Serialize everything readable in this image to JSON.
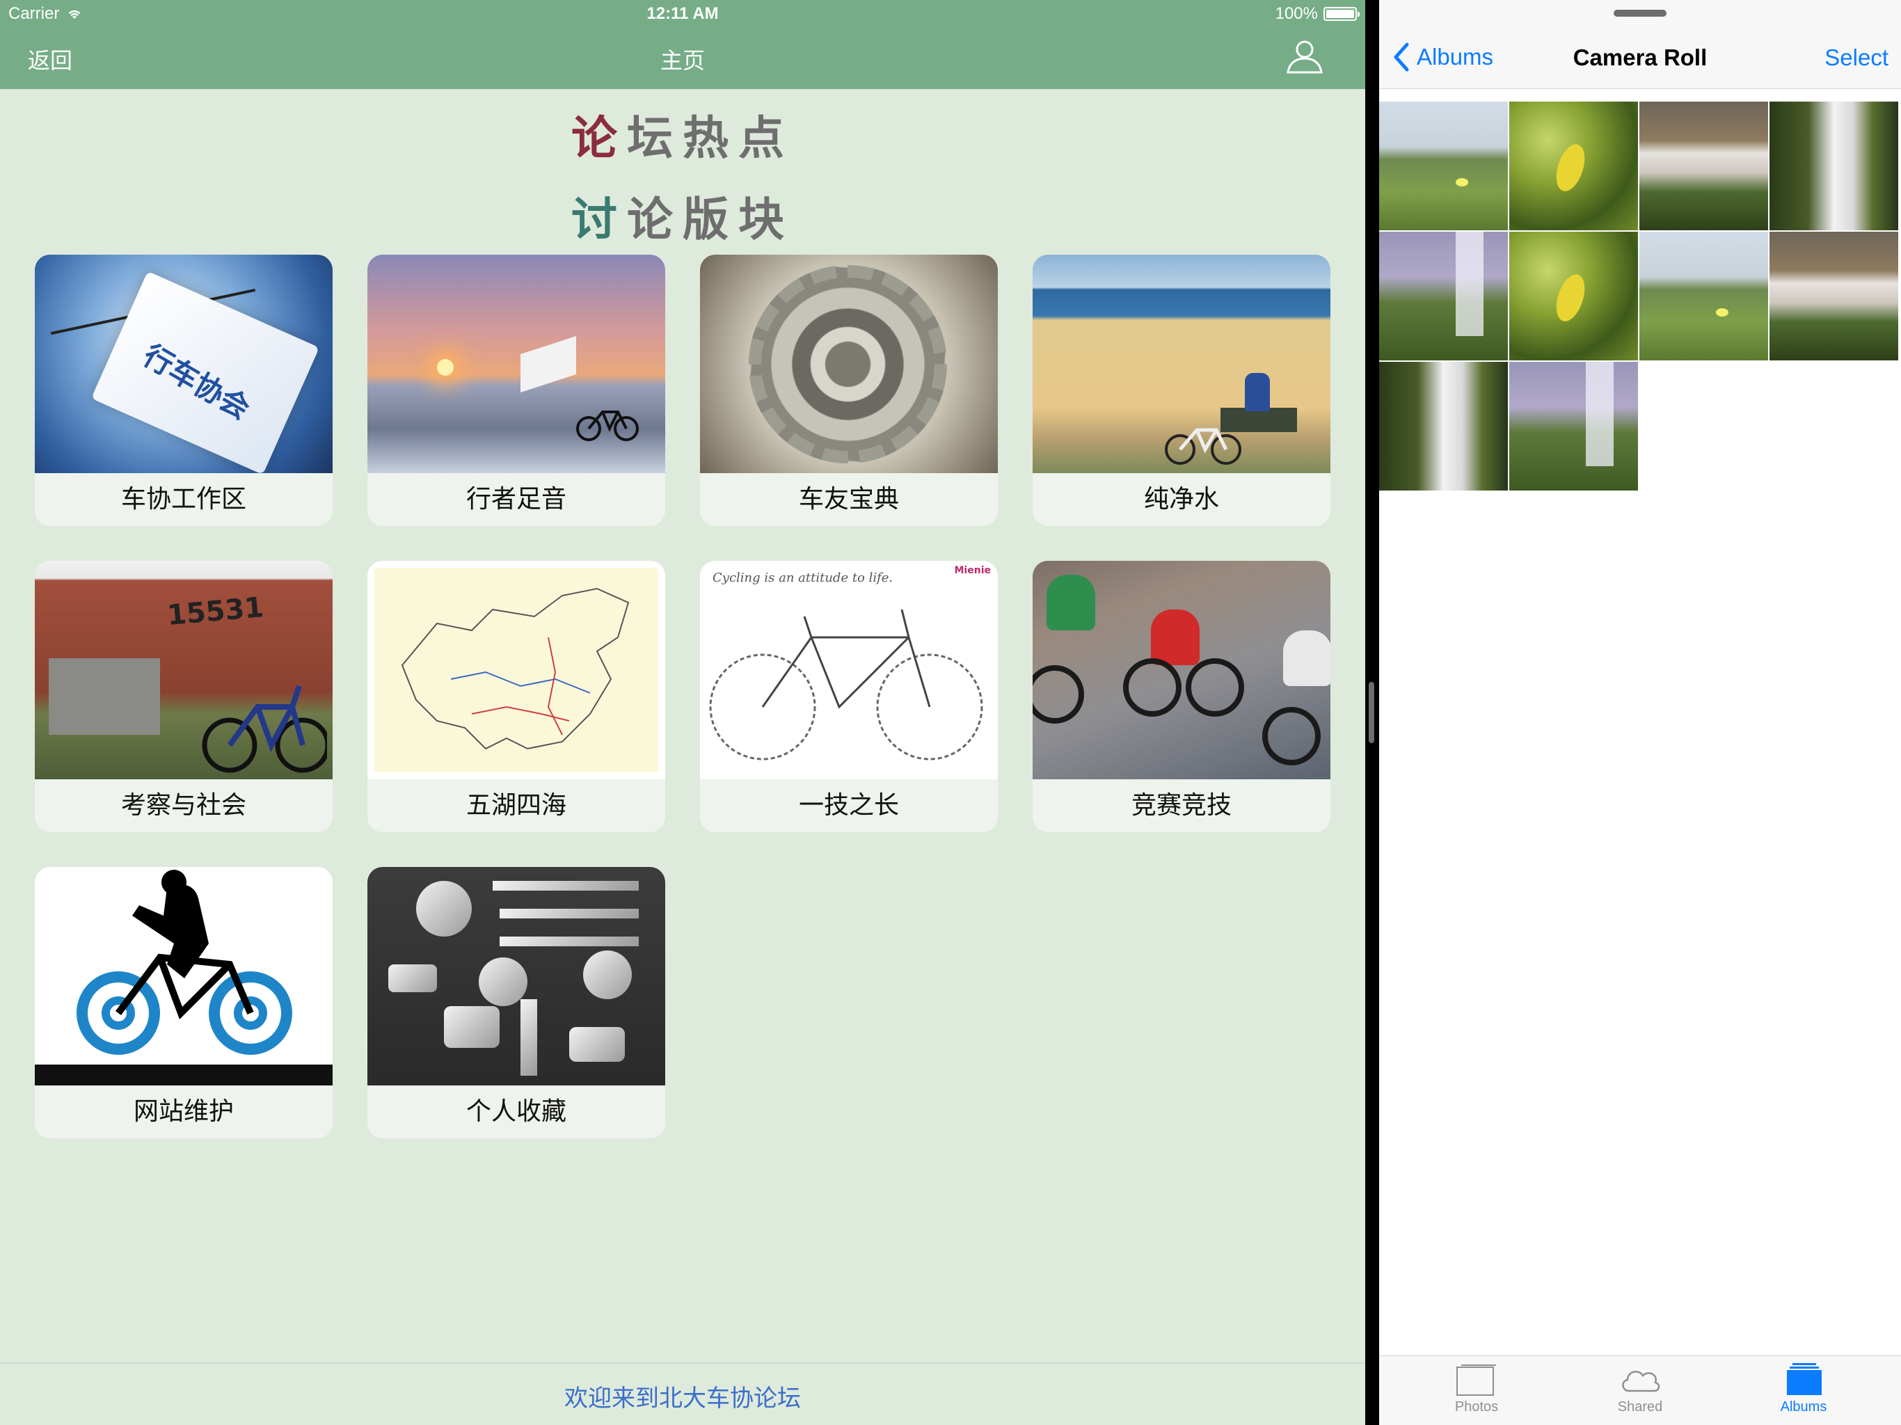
{
  "status_bar": {
    "carrier": "Carrier",
    "time": "12:11 AM",
    "battery": "100%"
  },
  "left_app": {
    "nav": {
      "back_label": "返回",
      "title": "主页",
      "user_icon": "user-icon"
    },
    "banners": {
      "hot_first": "论",
      "hot_rest": "坛热点",
      "board_first": "讨",
      "board_rest": "论版块"
    },
    "boards": [
      {
        "label": "车协工作区",
        "thumb_text": "行车协会"
      },
      {
        "label": "行者足音"
      },
      {
        "label": "车友宝典"
      },
      {
        "label": "纯净水"
      },
      {
        "label": "考察与社会",
        "thumb_text": "15531"
      },
      {
        "label": "五湖四海"
      },
      {
        "label": "一技之长",
        "thumb_text": "Cycling is an attitude to life.",
        "brand": "Mienie"
      },
      {
        "label": "竞赛竞技"
      },
      {
        "label": "网站维护"
      },
      {
        "label": "个人收藏"
      }
    ],
    "footer": "欢迎来到北大车协论坛",
    "colors": {
      "nav": "#76ad86",
      "background": "#deeadc",
      "footer_text": "#3b6fcb"
    }
  },
  "right_app": {
    "nav": {
      "back_label": "Albums",
      "title": "Camera Roll",
      "select_label": "Select"
    },
    "photos": [
      "grass",
      "leaf",
      "falls",
      "waterfall",
      "mist",
      "leaf",
      "grass",
      "falls",
      "waterfall",
      "mist"
    ],
    "tabs": [
      {
        "label": "Photos",
        "icon": "photos-icon",
        "active": false
      },
      {
        "label": "Shared",
        "icon": "cloud-icon",
        "active": false
      },
      {
        "label": "Albums",
        "icon": "albums-icon",
        "active": true
      }
    ],
    "colors": {
      "tint": "#0b7cff"
    }
  }
}
